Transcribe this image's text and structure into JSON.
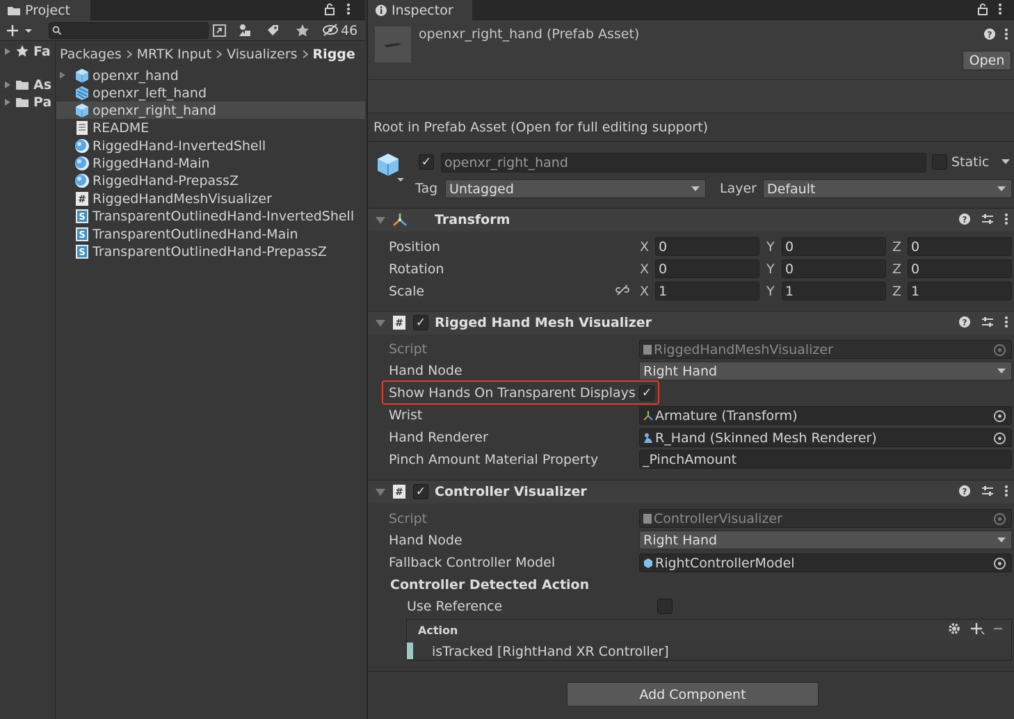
{
  "project": {
    "tab_label": "Project",
    "search_placeholder": "",
    "hidden_count": "46",
    "nav": [
      "Fa",
      "As",
      "Pa"
    ],
    "breadcrumb": [
      "Packages",
      "MRTK Input",
      "Visualizers",
      "Rigge"
    ],
    "files": [
      {
        "name": "openxr_hand",
        "icon": "prefab-icon"
      },
      {
        "name": "openxr_left_hand",
        "icon": "prefab-variant-icon"
      },
      {
        "name": "openxr_right_hand",
        "icon": "prefab-icon",
        "selected": true
      },
      {
        "name": "README",
        "icon": "text-doc-icon"
      },
      {
        "name": "RiggedHand-InvertedShell",
        "icon": "material-icon"
      },
      {
        "name": "RiggedHand-Main",
        "icon": "material-icon"
      },
      {
        "name": "RiggedHand-PrepassZ",
        "icon": "material-icon"
      },
      {
        "name": "RiggedHandMeshVisualizer",
        "icon": "csharp-script-icon"
      },
      {
        "name": "TransparentOutlinedHand-InvertedShell",
        "icon": "shader-icon"
      },
      {
        "name": "TransparentOutlinedHand-Main",
        "icon": "shader-icon"
      },
      {
        "name": "TransparentOutlinedHand-PrepassZ",
        "icon": "shader-icon"
      }
    ]
  },
  "inspector": {
    "tab_label": "Inspector",
    "asset_title": "openxr_right_hand (Prefab Asset)",
    "open_button": "Open",
    "root_info": "Root in Prefab Asset (Open for full editing support)",
    "object_name": "openxr_right_hand",
    "static_label": "Static",
    "tag_label": "Tag",
    "tag_value": "Untagged",
    "layer_label": "Layer",
    "layer_value": "Default",
    "transform": {
      "title": "Transform",
      "rows": [
        {
          "label": "Position",
          "x": "0",
          "y": "0",
          "z": "0"
        },
        {
          "label": "Rotation",
          "x": "0",
          "y": "0",
          "z": "0"
        },
        {
          "label": "Scale",
          "x": "1",
          "y": "1",
          "z": "1"
        }
      ],
      "axis": {
        "x": "X",
        "y": "Y",
        "z": "Z"
      }
    },
    "rigged": {
      "title": "Rigged Hand Mesh Visualizer",
      "script_label": "Script",
      "script_value": "RiggedHandMeshVisualizer",
      "hand_node_label": "Hand Node",
      "hand_node_value": "Right Hand",
      "show_hands_label": "Show Hands On Transparent Displays",
      "show_hands_checked": true,
      "wrist_label": "Wrist",
      "wrist_value": "Armature (Transform)",
      "renderer_label": "Hand Renderer",
      "renderer_value": "R_Hand (Skinned Mesh Renderer)",
      "pinch_label": "Pinch Amount Material Property",
      "pinch_value": "_PinchAmount"
    },
    "controller": {
      "title": "Controller Visualizer",
      "script_label": "Script",
      "script_value": "ControllerVisualizer",
      "hand_node_label": "Hand Node",
      "hand_node_value": "Right Hand",
      "fallback_label": "Fallback Controller Model",
      "fallback_value": "RightControllerModel",
      "detected_label": "Controller Detected Action",
      "use_ref_label": "Use Reference",
      "action_header": "Action",
      "action_item": "isTracked [RightHand XR Controller]"
    },
    "add_component": "Add Component"
  },
  "colors": {
    "highlight_box": "#e23b2e",
    "accent_check": "#e6e6e6"
  }
}
